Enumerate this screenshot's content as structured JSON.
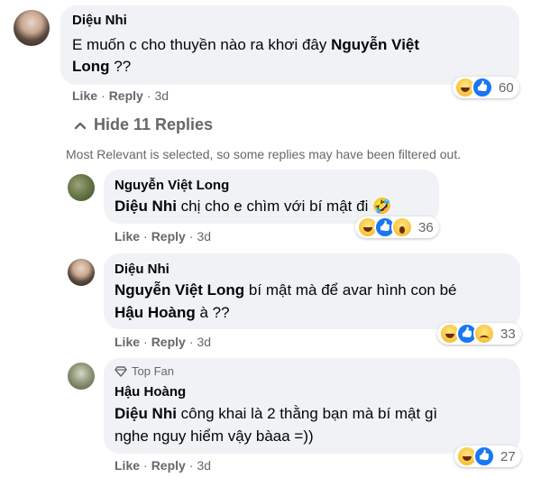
{
  "comment": {
    "author": "Diệu Nhi",
    "text_line1": "E muốn c cho thuyền nào ra khơi đây ",
    "tag": "Nguyễn Việt",
    "tag2": "Long",
    "text_end": " ??",
    "like": "Like",
    "reply": "Reply",
    "time": "3d",
    "reaction_count": "60"
  },
  "hide_replies_label": "Hide 11 Replies",
  "filter_notice": "Most Relevant is selected, so some replies may have been filtered out.",
  "replies": [
    {
      "author": "Nguyễn Việt Long",
      "tag": "Diệu Nhi",
      "text": " chị cho e chìm với bí mật đi 🤣",
      "like": "Like",
      "reply": "Reply",
      "time": "3d",
      "reaction_count": "36"
    },
    {
      "author": "Diệu Nhi",
      "tag": "Nguyễn Việt Long",
      "text": " bí mật mà để avar hình con bé",
      "tag2": "Hậu Hoàng",
      "text2": " à ??",
      "like": "Like",
      "reply": "Reply",
      "time": "3d",
      "reaction_count": "33"
    },
    {
      "badge": "Top Fan",
      "author": "Hậu Hoàng",
      "tag": "Diệu Nhi",
      "text": " công khai là 2 thằng bạn mà bí mật gì",
      "text2": "nghe nguy hiểm vậy bàaa =))",
      "like": "Like",
      "reply": "Reply",
      "time": "3d",
      "reaction_count": "27"
    }
  ]
}
